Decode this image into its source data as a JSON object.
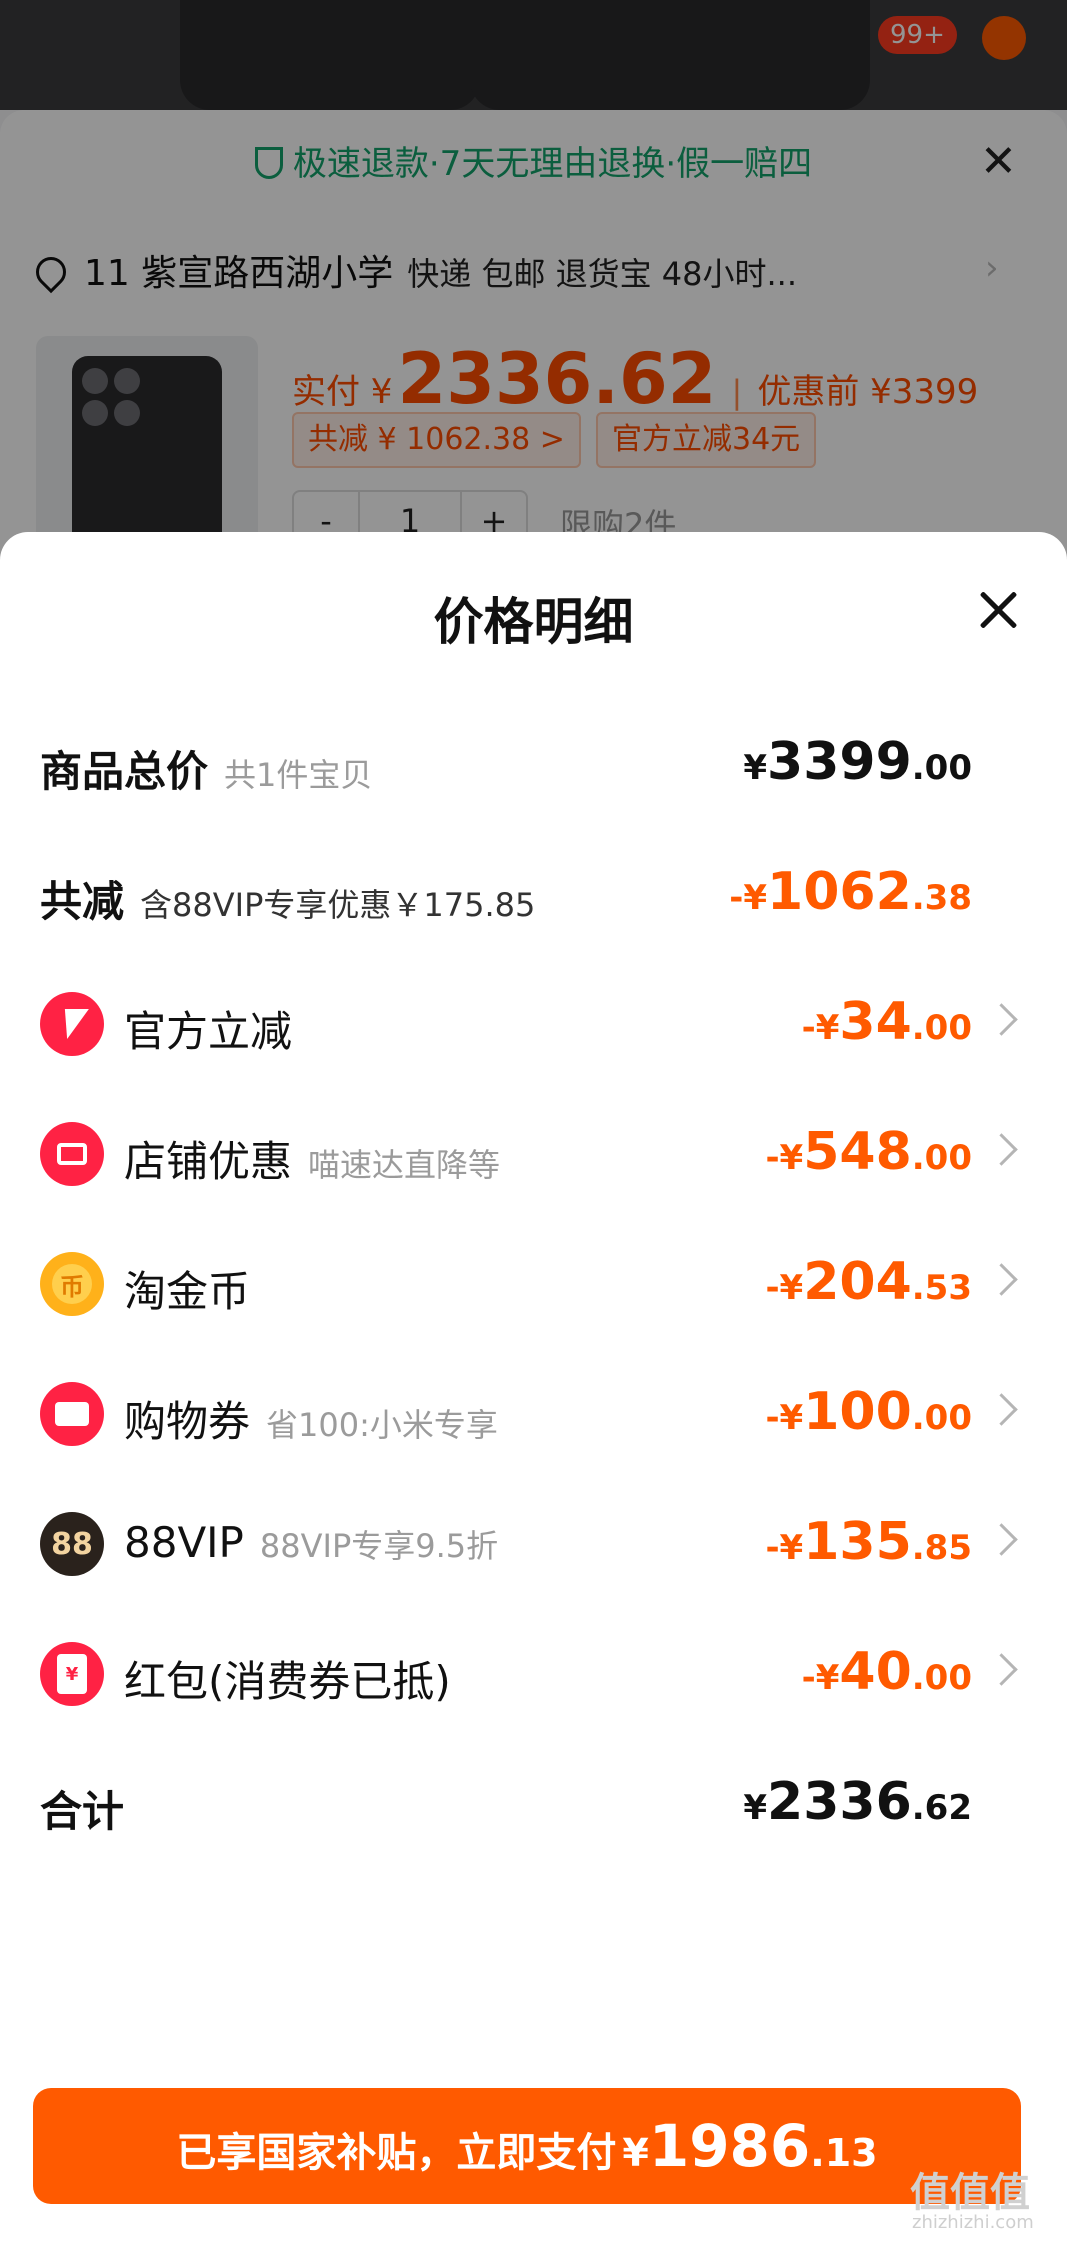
{
  "background": {
    "cart_badge": "99+",
    "guarantee": "极速退款·7天无理由退换·假一赔四",
    "address": "11 紫宣路西湖小学",
    "shipping": "快递 包邮 退货宝 48小时...",
    "actual_label": "实付 ¥",
    "actual_price": "2336.62",
    "before_discount": "优惠前 ¥3399",
    "tag_total_discount": "共减 ¥ 1062.38 >",
    "tag_official": "官方立减34元",
    "qty_minus": "-",
    "qty_value": "1",
    "qty_plus": "+",
    "limit": "限购2件"
  },
  "sheet": {
    "title": "价格明细"
  },
  "rows": {
    "goods_total": {
      "label": "商品总价",
      "sub": "共1件宝贝",
      "cur": "¥",
      "int": "3399",
      "dec": ".00"
    },
    "total_discount": {
      "label": "共减",
      "sub": "含88VIP专享优惠￥175.85",
      "cur": "-¥",
      "int": "1062",
      "dec": ".38"
    },
    "official": {
      "label": "官方立减",
      "sub": "",
      "cur": "-¥",
      "int": "34",
      "dec": ".00",
      "icon": "lightning-icon"
    },
    "store": {
      "label": "店铺优惠",
      "sub": "喵速达直降等",
      "cur": "-¥",
      "int": "548",
      "dec": ".00",
      "icon": "store-icon"
    },
    "coins": {
      "label": "淘金币",
      "sub": "",
      "cur": "-¥",
      "int": "204",
      "dec": ".53",
      "icon": "coin-icon",
      "icon_text": "币"
    },
    "coupon": {
      "label": "购物券",
      "sub": "省100:小米专享",
      "cur": "-¥",
      "int": "100",
      "dec": ".00",
      "icon": "ticket-icon"
    },
    "vip": {
      "label": "88VIP",
      "sub": "88VIP专享9.5折",
      "cur": "-¥",
      "int": "135",
      "dec": ".85",
      "icon": "88vip-icon",
      "icon_text": "88"
    },
    "redpacket": {
      "label": "红包(消费券已抵)",
      "sub": "",
      "cur": "-¥",
      "int": "40",
      "dec": ".00",
      "icon": "red-envelope-icon",
      "icon_text": "¥"
    },
    "sum": {
      "label": "合计",
      "cur": "¥",
      "int": "2336",
      "dec": ".62"
    }
  },
  "pay_button": {
    "text": "已享国家补贴，立即支付",
    "cur": "¥",
    "int": "1986",
    "dec": ".13"
  },
  "watermark": {
    "main": "值值值",
    "sub": "zhizhizhi.com"
  },
  "colors": {
    "accent": "#ff5a00",
    "icon_red": "#ff2244",
    "guarantee_green": "#13a36b"
  }
}
